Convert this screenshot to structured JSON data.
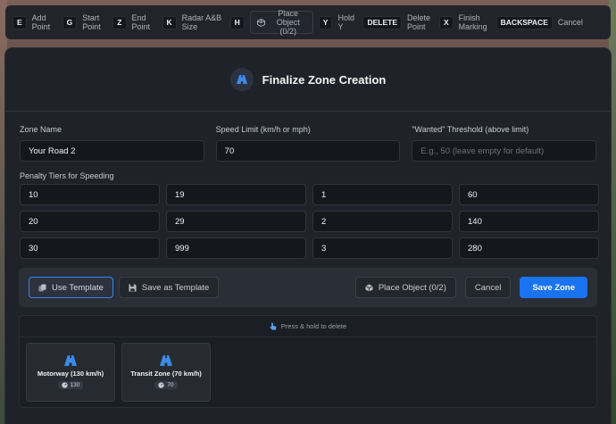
{
  "keybar": {
    "items": [
      {
        "key": "E",
        "label": "Add Point"
      },
      {
        "key": "G",
        "label": "Start Point"
      },
      {
        "key": "Z",
        "label": "End Point"
      },
      {
        "key": "K",
        "label": "Radar A&B Size"
      },
      {
        "key": "H",
        "label": "Place Object (0/2)"
      },
      {
        "key": "Y",
        "label": "Hold Y"
      },
      {
        "key": "DELETE",
        "label": "Delete Point"
      },
      {
        "key": "X",
        "label": "Finish Marking"
      },
      {
        "key": "BACKSPACE",
        "label": "Cancel"
      }
    ]
  },
  "modal": {
    "title": "Finalize Zone Creation",
    "zone_name": {
      "label": "Zone Name",
      "value": "Your Road 2"
    },
    "speed_limit": {
      "label": "Speed Limit (km/h or mph)",
      "value": "70"
    },
    "wanted": {
      "label": "\"Wanted\" Threshold (above limit)",
      "placeholder": "E.g., 50 (leave empty for default)"
    },
    "tiers_label": "Penalty Tiers for Speeding",
    "tiers": [
      [
        "10",
        "19",
        "1",
        "60"
      ],
      [
        "20",
        "29",
        "2",
        "140"
      ],
      [
        "30",
        "999",
        "3",
        "280"
      ]
    ],
    "actions": {
      "use_template": "Use Template",
      "save_as_template": "Save as Template",
      "place_object": "Place Object (0/2)",
      "cancel": "Cancel",
      "save_zone": "Save Zone"
    },
    "templates_hint": "Press & hold to delete",
    "templates": [
      {
        "name": "Motorway (130 km/h)",
        "speed": "130"
      },
      {
        "name": "Transit Zone (70 km/h)",
        "speed": "70"
      }
    ]
  },
  "colors": {
    "accent": "#1a73f0",
    "road_icon": "#3b8ce8"
  },
  "icons": {
    "header": "road-icon",
    "template_card": "road-icon",
    "place_object": "cube-icon",
    "use_template": "copy-icon",
    "save_template": "floppy-icon",
    "hint": "hand-pointer-icon",
    "badge": "speedometer-icon"
  }
}
